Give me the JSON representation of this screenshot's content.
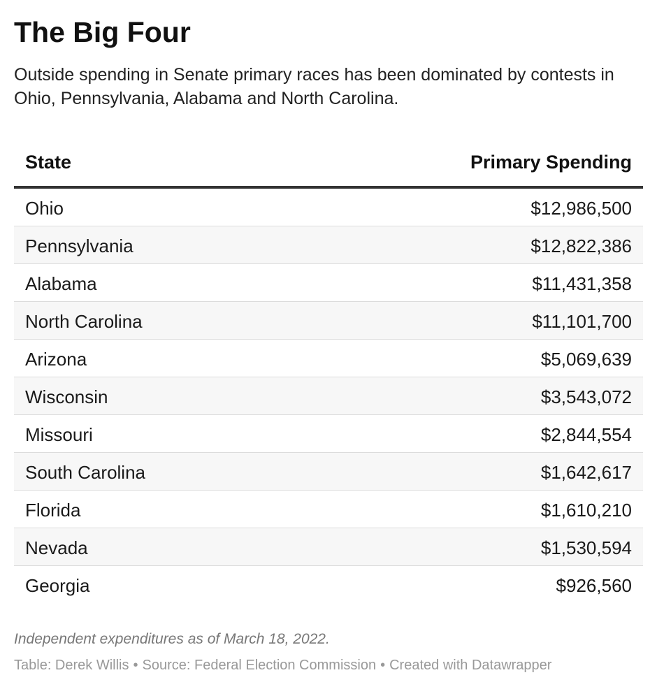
{
  "title": "The Big Four",
  "description": "Outside spending in Senate primary races has been dominated by contests in Ohio, Pennsylvania, Alabama and North Carolina.",
  "chart_data": {
    "type": "table",
    "columns": [
      "State",
      "Primary Spending"
    ],
    "rows": [
      {
        "state": "Ohio",
        "spending": "$12,986,500",
        "value": 12986500
      },
      {
        "state": "Pennsylvania",
        "spending": "$12,822,386",
        "value": 12822386
      },
      {
        "state": "Alabama",
        "spending": "$11,431,358",
        "value": 11431358
      },
      {
        "state": "North Carolina",
        "spending": "$11,101,700",
        "value": 11101700
      },
      {
        "state": "Arizona",
        "spending": "$5,069,639",
        "value": 5069639
      },
      {
        "state": "Wisconsin",
        "spending": "$3,543,072",
        "value": 3543072
      },
      {
        "state": "Missouri",
        "spending": "$2,844,554",
        "value": 2844554
      },
      {
        "state": "South Carolina",
        "spending": "$1,642,617",
        "value": 1642617
      },
      {
        "state": "Florida",
        "spending": "$1,610,210",
        "value": 1610210
      },
      {
        "state": "Nevada",
        "spending": "$1,530,594",
        "value": 1530594
      },
      {
        "state": "Georgia",
        "spending": "$926,560",
        "value": 926560
      }
    ]
  },
  "note": "Independent expenditures as of March 18, 2022.",
  "footer": {
    "table_credit": "Table: Derek Willis",
    "separator": "•",
    "source": "Source: Federal Election Commission",
    "created_with": "Created with Datawrapper"
  },
  "colors": {
    "stripe": "#f7f7f7",
    "header_rule": "#333333",
    "row_rule": "#dcdcdc",
    "note": "#777777",
    "footer": "#999999"
  }
}
